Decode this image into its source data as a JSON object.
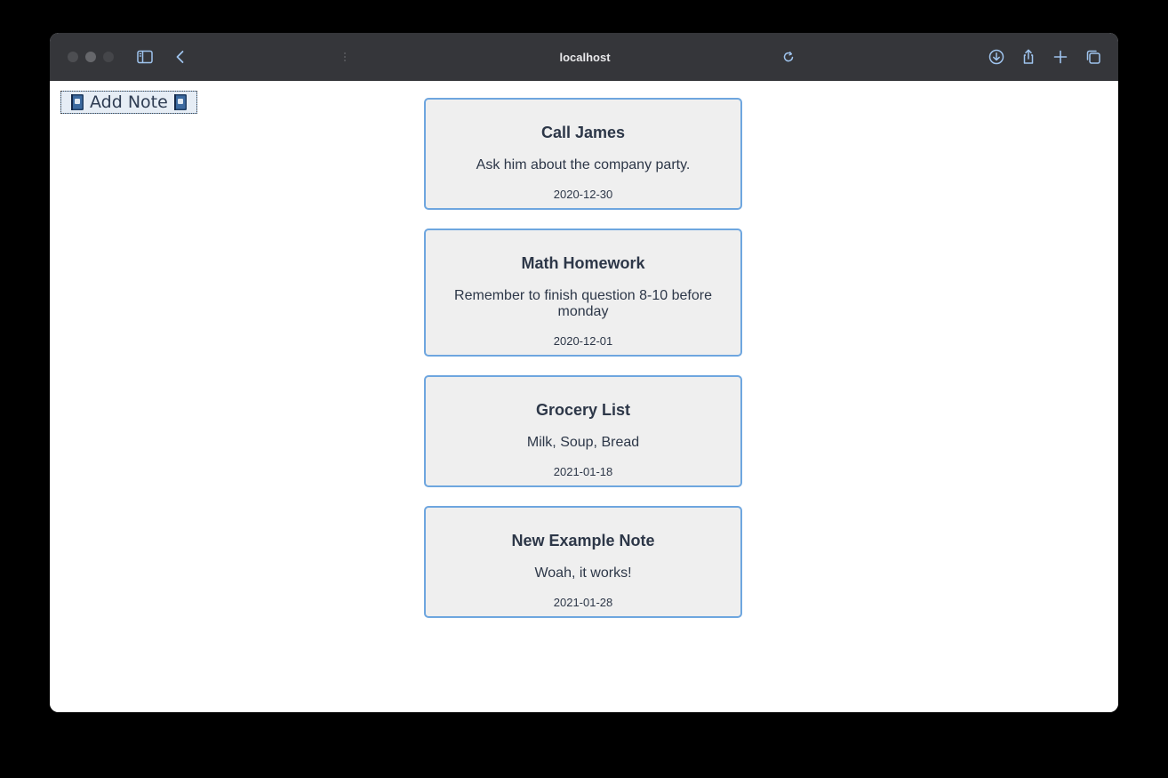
{
  "browser": {
    "address": "localhost",
    "icons": {
      "sidebar": "sidebar-icon",
      "back": "chevron-left-icon",
      "reload": "reload-icon",
      "download": "download-icon",
      "share": "share-icon",
      "new_tab": "plus-icon",
      "tabs": "tabs-overview-icon"
    }
  },
  "toolbar": {
    "add_note_label": "Add Note",
    "icon": "book-icon"
  },
  "notes": [
    {
      "title": "Call James",
      "body": "Ask him about the company party.",
      "date": "2020-12-30"
    },
    {
      "title": "Math Homework",
      "body": "Remember to finish question 8-10 before monday",
      "date": "2020-12-01"
    },
    {
      "title": "Grocery List",
      "body": "Milk, Soup, Bread",
      "date": "2021-01-18"
    },
    {
      "title": "New Example Note",
      "body": "Woah, it works!",
      "date": "2021-01-28"
    }
  ],
  "colors": {
    "note_border": "#6ea6df",
    "note_background": "#efefef",
    "text": "#2d3748"
  }
}
